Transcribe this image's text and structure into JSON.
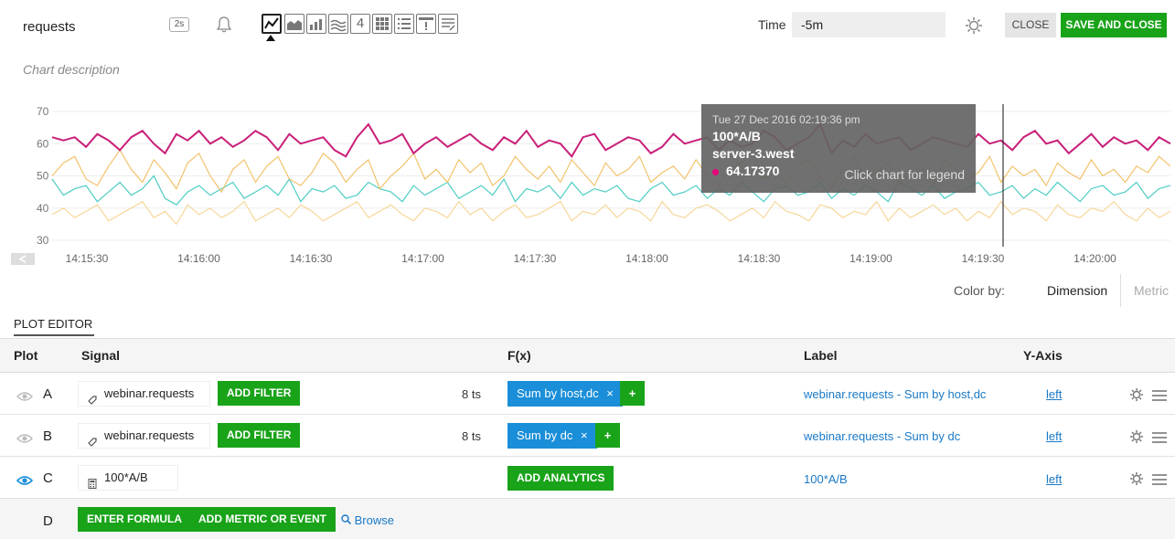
{
  "header": {
    "chart_name": "requests",
    "refresh_badge": "2s",
    "time_label": "Time",
    "time_value": "-5m",
    "close_label": "CLOSE",
    "save_label": "SAVE AND CLOSE",
    "description_placeholder": "Chart description",
    "viz_types": [
      "line-chart-icon",
      "area-chart-icon",
      "column-chart-icon",
      "histogram-icon",
      "single-value-icon",
      "heatmap-icon",
      "list-icon",
      "event-feed-icon",
      "text-note-icon"
    ],
    "single_value_icon_label": "4"
  },
  "chart_data": {
    "type": "line",
    "y_ticks": [
      "70",
      "60",
      "50",
      "40",
      "30"
    ],
    "ylim": [
      30,
      70
    ],
    "x_ticks": [
      "14:15:30",
      "14:16:00",
      "14:16:30",
      "14:17:00",
      "14:17:30",
      "14:18:00",
      "14:18:30",
      "14:19:00",
      "14:19:30",
      "14:20:00"
    ],
    "grid": true,
    "series": [
      {
        "color": "#c9207a",
        "values": [
          62,
          61,
          62,
          59,
          63,
          61,
          58,
          62,
          64,
          60,
          57,
          63,
          61,
          64,
          60,
          62,
          59,
          61,
          64,
          62,
          58,
          63,
          60,
          61,
          62,
          58,
          56,
          62,
          66,
          60,
          61,
          63,
          57,
          60,
          62,
          59,
          61,
          63,
          60,
          58,
          62,
          60,
          64,
          59,
          61,
          60,
          56,
          62,
          63,
          58,
          60,
          62,
          61,
          57,
          59,
          63,
          60,
          61,
          62,
          58,
          61,
          59,
          60,
          64,
          62,
          58,
          60,
          62,
          66,
          57,
          61,
          59,
          63,
          60,
          61,
          62,
          58,
          60,
          62,
          61,
          60,
          59,
          63,
          60,
          61,
          58,
          62,
          64,
          60,
          61,
          57,
          60,
          63,
          59,
          62,
          60,
          61,
          58,
          62,
          60
        ]
      },
      {
        "color": "#f2c26b",
        "values": [
          50,
          54,
          56,
          49,
          47,
          53,
          58,
          52,
          48,
          55,
          51,
          46,
          54,
          57,
          50,
          45,
          52,
          55,
          48,
          53,
          56,
          49,
          47,
          51,
          57,
          54,
          48,
          52,
          55,
          46,
          50,
          53,
          57,
          49,
          52,
          48,
          55,
          51,
          54,
          47,
          50,
          56,
          52,
          49,
          53,
          48,
          55,
          51,
          47,
          54,
          50,
          52,
          56,
          48,
          51,
          53,
          49,
          55,
          50,
          47,
          52,
          54,
          57,
          49,
          51,
          48,
          53,
          55,
          50,
          46,
          52,
          56,
          49,
          51,
          54,
          48,
          50,
          53,
          47,
          55,
          52,
          49,
          51,
          56,
          48,
          53,
          50,
          52,
          47,
          54,
          51,
          49,
          55,
          50,
          52,
          48,
          53,
          51,
          56,
          53
        ]
      },
      {
        "color": "#4ecdc4",
        "values": [
          49,
          44,
          46,
          47,
          42,
          45,
          48,
          44,
          46,
          50,
          43,
          41,
          45,
          47,
          44,
          46,
          48,
          43,
          45,
          47,
          44,
          49,
          42,
          46,
          45,
          47,
          43,
          44,
          48,
          46,
          45,
          42,
          47,
          44,
          46,
          48,
          43,
          45,
          47,
          44,
          49,
          42,
          46,
          45,
          47,
          43,
          48,
          44,
          46,
          45,
          47,
          43,
          42,
          46,
          48,
          44,
          45,
          47,
          43,
          46,
          44,
          48,
          45,
          42,
          46,
          47,
          44,
          45,
          48,
          43,
          46,
          44,
          47,
          45,
          42,
          48,
          46,
          44,
          47,
          43,
          45,
          46,
          48,
          44,
          45,
          47,
          43,
          46,
          44,
          48,
          45,
          42,
          46,
          47,
          44,
          45,
          48,
          43,
          46,
          47
        ]
      },
      {
        "color": "#f7d79a",
        "values": [
          38,
          40,
          37,
          39,
          41,
          36,
          38,
          40,
          42,
          37,
          39,
          35,
          41,
          38,
          40,
          37,
          39,
          42,
          36,
          38,
          40,
          37,
          41,
          39,
          36,
          38,
          40,
          42,
          37,
          39,
          41,
          38,
          36,
          40,
          39,
          37,
          42,
          38,
          40,
          36,
          39,
          41,
          37,
          38,
          40,
          42,
          36,
          39,
          38,
          41,
          37,
          40,
          39,
          36,
          42,
          38,
          37,
          40,
          41,
          39,
          36,
          38,
          40,
          37,
          42,
          39,
          38,
          36,
          41,
          40,
          37,
          39,
          38,
          42,
          36,
          40,
          37,
          39,
          41,
          38,
          40,
          36,
          39,
          37,
          42,
          38,
          40,
          39,
          36,
          41,
          38,
          37,
          40,
          39,
          42,
          38,
          36,
          40,
          37,
          39
        ]
      }
    ],
    "tooltip": {
      "date": "Tue 27 Dec 2016 02:19:36 pm",
      "series": "100*A/B",
      "host": "server-3.west",
      "value": "64.17370",
      "hint": "Click chart for legend"
    }
  },
  "color_by": {
    "label": "Color by:",
    "dimension": "Dimension",
    "metric": "Metric"
  },
  "plot_editor": {
    "tab_label": "PLOT EDITOR",
    "headers": {
      "plot": "Plot",
      "signal": "Signal",
      "fx": "F(x)",
      "label": "Label",
      "yaxis": "Y-Axis"
    },
    "rows": [
      {
        "letter": "A",
        "signal": "webinar.requests",
        "filter_label": "ADD FILTER",
        "ts": "8 ts",
        "fx": "Sum by host,dc",
        "fx_remove": "×",
        "plus": "+",
        "label": "webinar.requests - Sum by host,dc",
        "yaxis": "left"
      },
      {
        "letter": "B",
        "signal": "webinar.requests",
        "filter_label": "ADD FILTER",
        "ts": "8 ts",
        "fx": "Sum by dc",
        "fx_remove": "×",
        "plus": "+",
        "label": "webinar.requests - Sum by dc",
        "yaxis": "left"
      },
      {
        "letter": "C",
        "signal": "100*A/B",
        "analytics_label": "ADD ANALYTICS",
        "label": "100*A/B",
        "yaxis": "left"
      },
      {
        "letter": "D",
        "formula_label": "ENTER FORMULA",
        "metric_label": "ADD METRIC OR EVENT",
        "browse_label": "Browse"
      }
    ]
  }
}
